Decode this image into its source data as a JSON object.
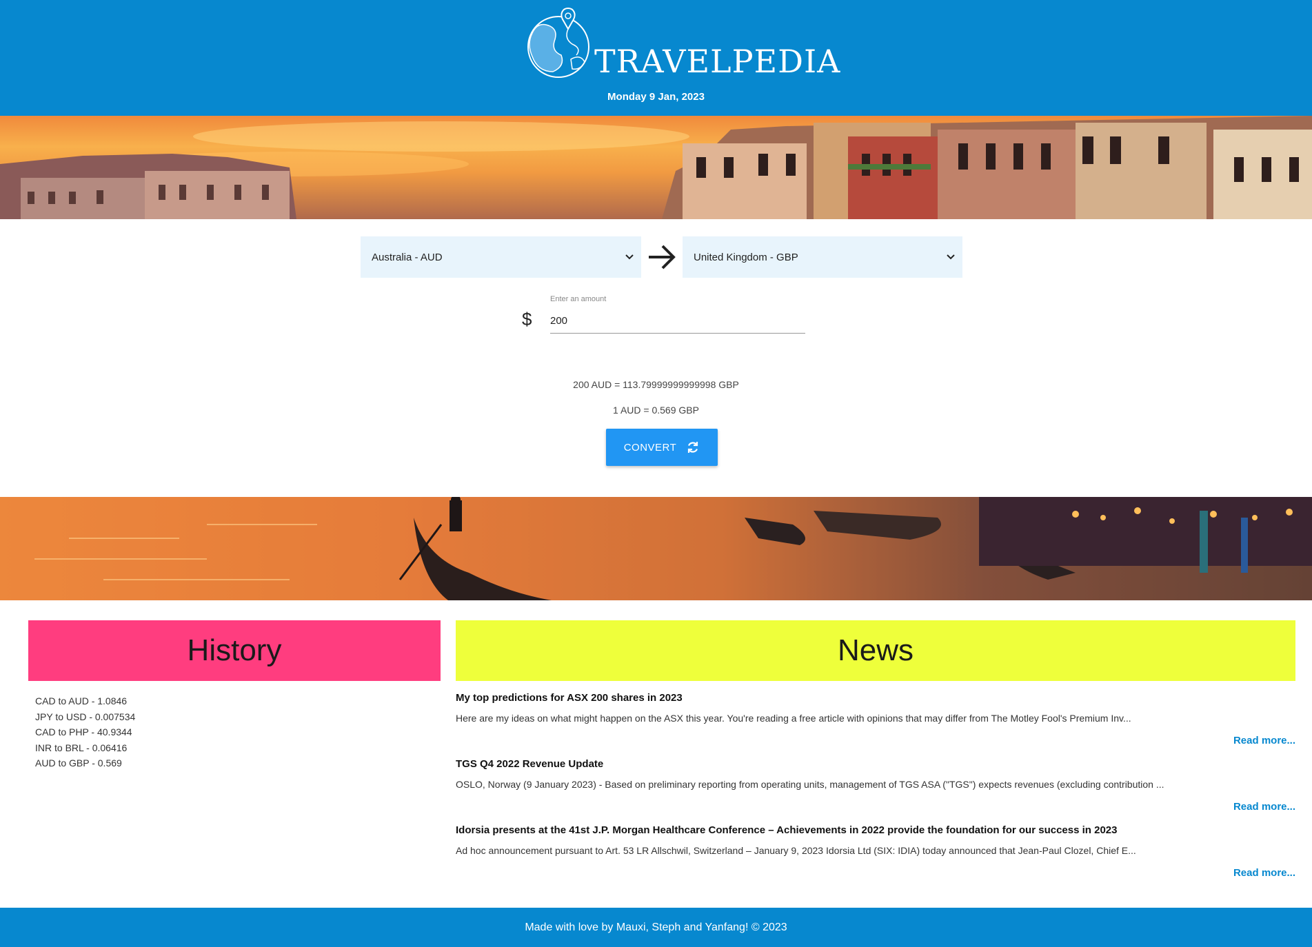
{
  "header": {
    "brand": "TRAVELPEDIA",
    "date": "Monday 9 Jan, 2023"
  },
  "converter": {
    "from_currency": "Australia - AUD",
    "to_currency": "United Kingdom - GBP",
    "amount_label": "Enter an amount",
    "amount_value": "200",
    "currency_symbol": "$",
    "result_line": "200 AUD = 113.79999999999998 GBP",
    "rate_line": "1 AUD = 0.569 GBP",
    "convert_label": "CONVERT"
  },
  "history": {
    "title": "History",
    "items": [
      "CAD to AUD - 1.0846",
      "JPY to USD - 0.007534",
      "CAD to PHP - 40.9344",
      "INR to BRL - 0.06416",
      "AUD to GBP - 0.569"
    ]
  },
  "news": {
    "title": "News",
    "items": [
      {
        "title": "My top predictions for ASX 200 shares in 2023",
        "description": "Here are my ideas on what might happen on the ASX this year. You're reading a free article with opinions that may differ from The Motley Fool's Premium Inv...",
        "link": "Read more..."
      },
      {
        "title": "TGS Q4 2022 Revenue Update",
        "description": "OSLO, Norway (9 January 2023) - Based on preliminary reporting from operating units, management of TGS ASA (\"TGS\") expects revenues (excluding contribution ...",
        "link": "Read more..."
      },
      {
        "title": "Idorsia presents at the 41st J.P. Morgan Healthcare Conference – Achievements in 2022 provide the foundation for our success in 2023",
        "description": "Ad hoc announcement pursuant to Art. 53 LR Allschwil, Switzerland – January 9, 2023 Idorsia Ltd (SIX: IDIA) today announced that Jean-Paul Clozel, Chief E...",
        "link": "Read more..."
      }
    ]
  },
  "footer": {
    "text": "Made with love by Mauxi, Steph and Yanfang! © 2023"
  },
  "colors": {
    "brand_blue": "#0788cf",
    "history_pink": "#ff3d7f",
    "news_yellow": "#eeff3b",
    "button_blue": "#2196f3"
  },
  "icons": [
    "globe-logo-icon",
    "chevron-down-icon",
    "arrow-right-icon",
    "dollar-icon",
    "refresh-icon"
  ]
}
